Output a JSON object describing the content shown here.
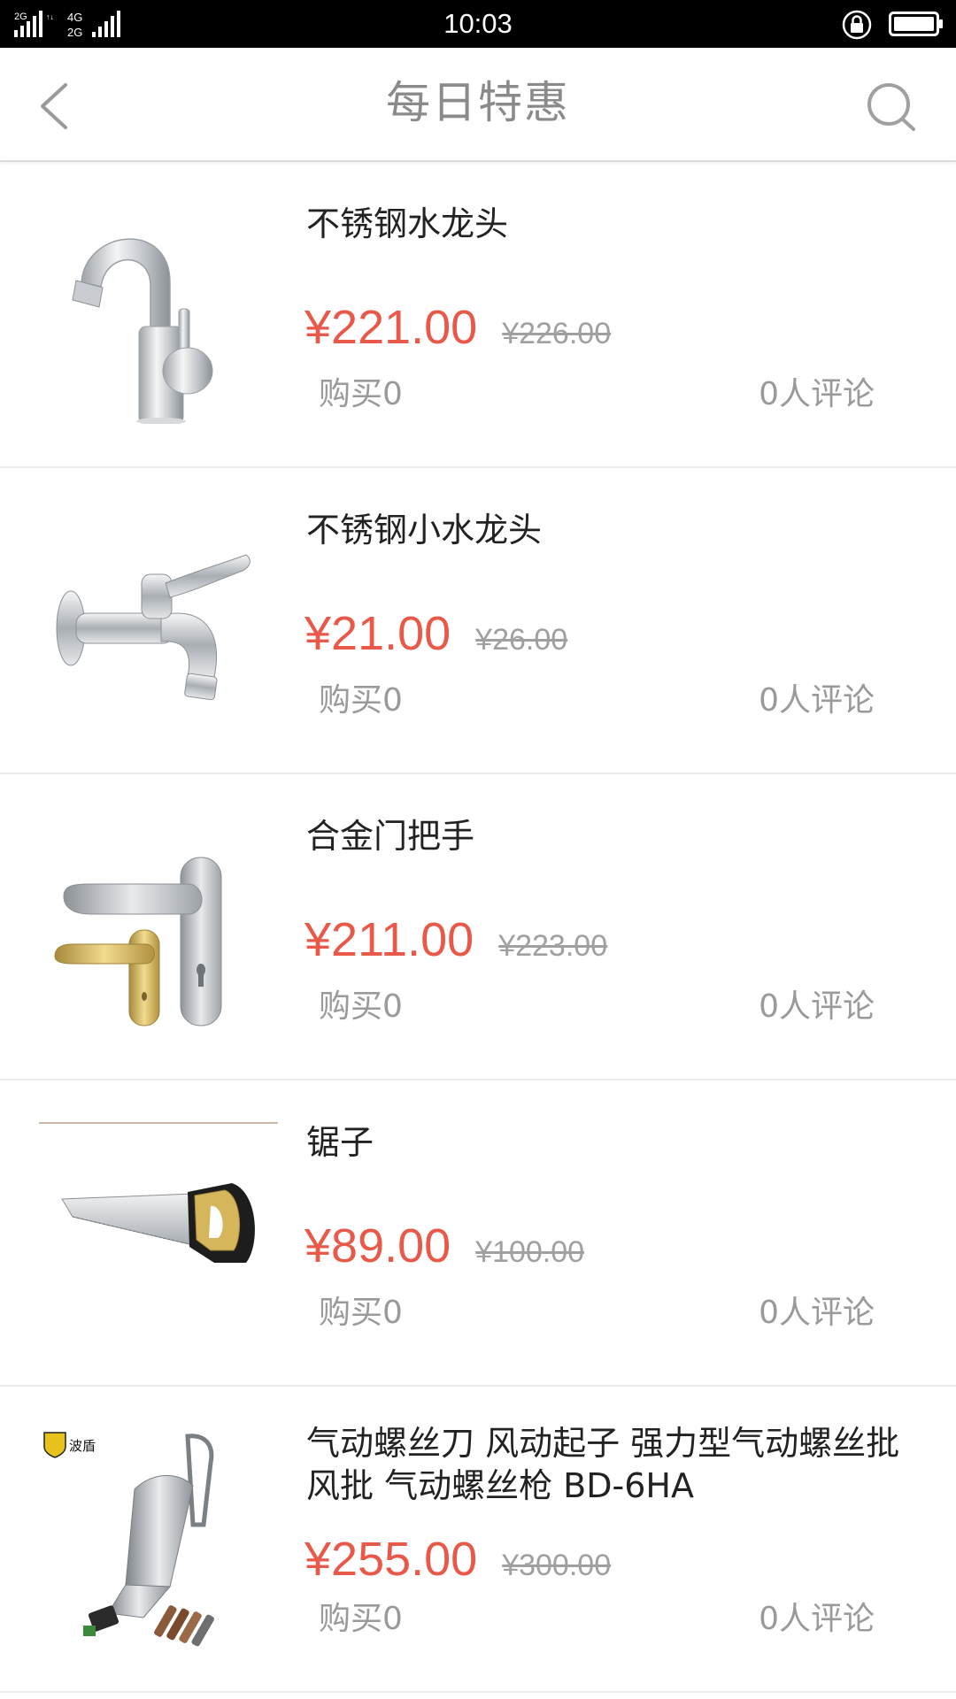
{
  "status_bar": {
    "time": "10:03",
    "signal_label": "2G 4G 2G",
    "icons": [
      "signal-icon",
      "rotation-lock-icon",
      "battery-icon"
    ]
  },
  "header": {
    "title": "每日特惠",
    "back_icon": "chevron-left-icon",
    "search_icon": "search-icon"
  },
  "colors": {
    "price": "#e8594a",
    "old_price": "#a0a0a0",
    "title": "#8a8a8a",
    "meta": "#9a9a9a"
  },
  "products": [
    {
      "name": "不锈钢水龙头",
      "price": "¥221.00",
      "old_price": "¥226.00",
      "buy": "购买0",
      "reviews": "0人评论",
      "image": "faucet-image"
    },
    {
      "name": "不锈钢小水龙头",
      "price": "¥21.00",
      "old_price": "¥26.00",
      "buy": "购买0",
      "reviews": "0人评论",
      "image": "small-faucet-image"
    },
    {
      "name": "合金门把手",
      "price": "¥211.00",
      "old_price": "¥223.00",
      "buy": "购买0",
      "reviews": "0人评论",
      "image": "door-handle-image"
    },
    {
      "name": "锯子",
      "price": "¥89.00",
      "old_price": "¥100.00",
      "buy": "购买0",
      "reviews": "0人评论",
      "image": "saw-image"
    },
    {
      "name": "气动螺丝刀 风动起子 强力型气动螺丝批 风批 气动螺丝枪 BD-6HA",
      "price": "¥255.00",
      "old_price": "¥300.00",
      "buy": "购买0",
      "reviews": "0人评论",
      "image": "pneumatic-screwdriver-image",
      "image_logo_text": "波盾"
    }
  ]
}
